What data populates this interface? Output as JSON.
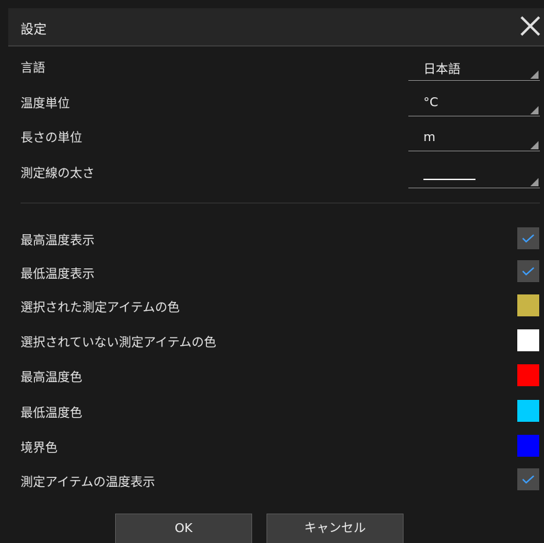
{
  "dialog": {
    "title": "設定"
  },
  "dropdowns": [
    {
      "label": "言語",
      "value": "日本語"
    },
    {
      "label": "温度単位",
      "value": "°C"
    },
    {
      "label": "長さの単位",
      "value": "m"
    },
    {
      "label": "測定線の太さ",
      "value": ""
    }
  ],
  "options": [
    {
      "label": "最高温度表示",
      "kind": "checkbox",
      "checked": true
    },
    {
      "label": "最低温度表示",
      "kind": "checkbox",
      "checked": true
    },
    {
      "label": "選択された測定アイテムの色",
      "kind": "color",
      "color": "#c8b445"
    },
    {
      "label": "選択されていない測定アイテムの色",
      "kind": "color",
      "color": "#ffffff"
    },
    {
      "label": "最高温度色",
      "kind": "color",
      "color": "#ff0000"
    },
    {
      "label": "最低温度色",
      "kind": "color",
      "color": "#00ccff"
    },
    {
      "label": "境界色",
      "kind": "color",
      "color": "#0000ff"
    },
    {
      "label": "測定アイテムの温度表示",
      "kind": "checkbox",
      "checked": true
    }
  ],
  "buttons": {
    "ok": "OK",
    "cancel": "キャンセル"
  },
  "colors": {
    "check_accent": "#3ea0ff"
  }
}
